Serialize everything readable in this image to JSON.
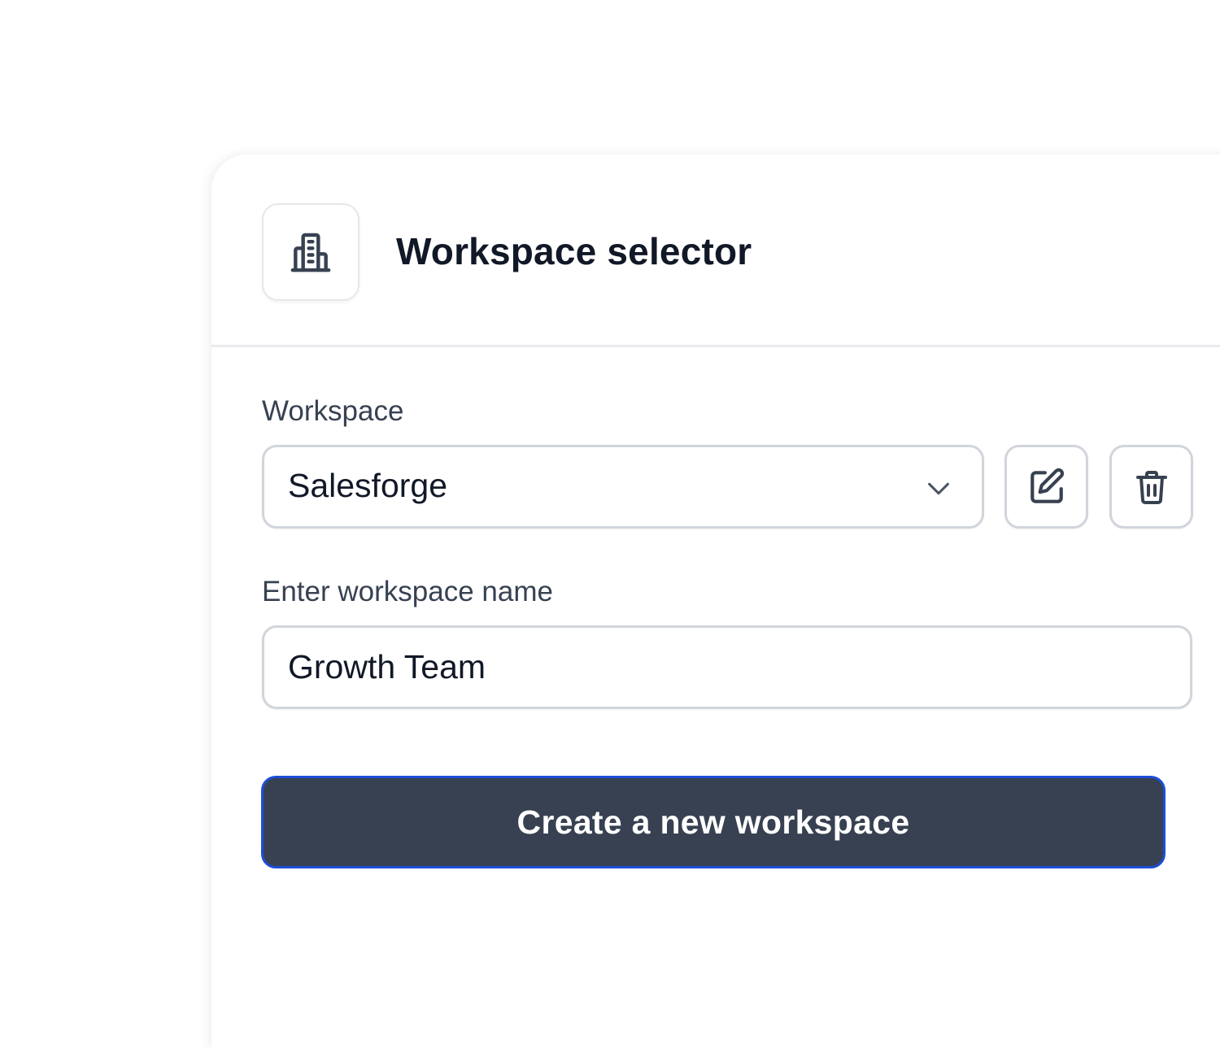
{
  "header": {
    "icon": "building-icon",
    "title": "Workspace selector"
  },
  "workspace_field": {
    "label": "Workspace",
    "selected_value": "Salesforge",
    "dropdown_icon": "chevron-down-icon",
    "edit_icon": "edit-icon",
    "delete_icon": "trash-icon"
  },
  "name_field": {
    "label": "Enter workspace name",
    "value": "Growth Team"
  },
  "actions": {
    "create_label": "Create a new workspace"
  },
  "colors": {
    "text_primary": "#111827",
    "text_label": "#374151",
    "border": "#d1d5db",
    "button_bg": "#374151",
    "button_border": "#1d4ed8",
    "button_text": "#ffffff"
  }
}
